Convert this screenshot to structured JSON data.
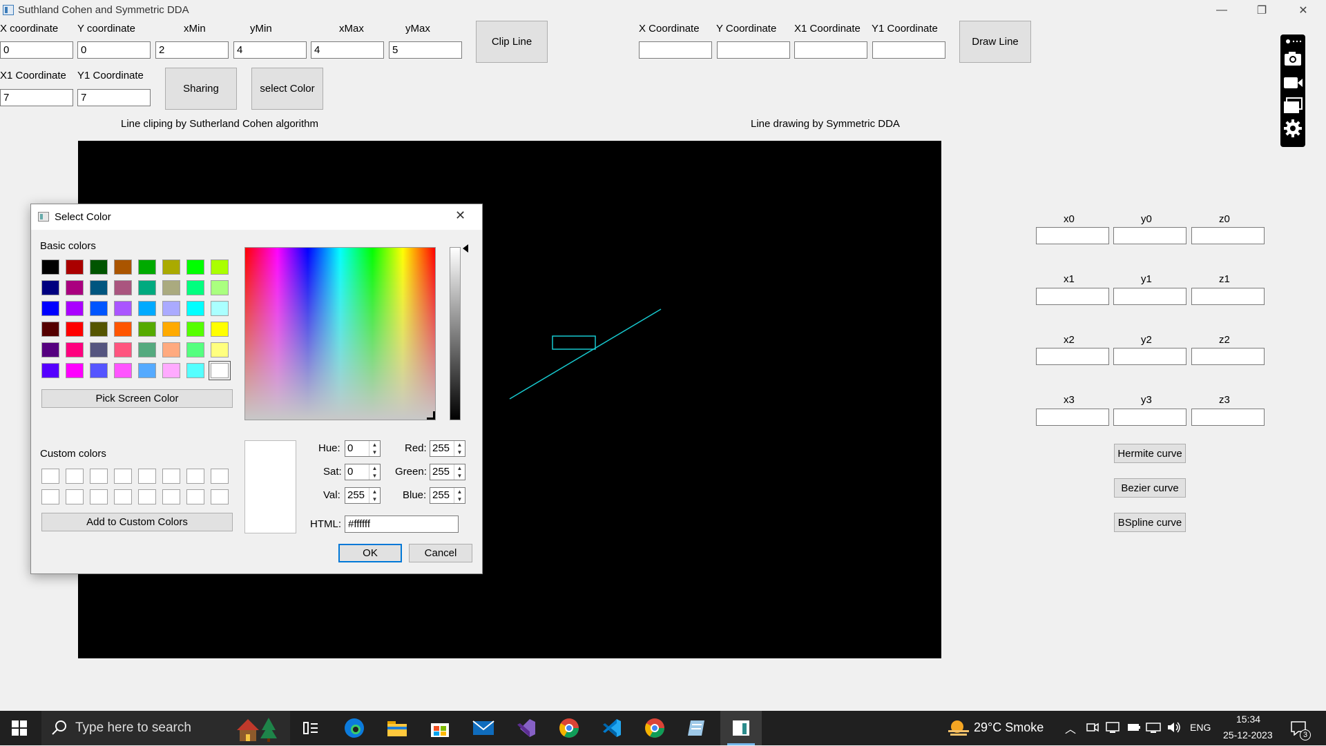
{
  "window": {
    "title": "Suthland Cohen and Symmetric DDA",
    "minimize": "—",
    "restore": "❐",
    "close": "✕"
  },
  "clip": {
    "labels": [
      "X coordinate",
      "Y coordinate",
      "xMin",
      "yMin",
      "xMax",
      "yMax"
    ],
    "values": [
      "0",
      "0",
      "2",
      "4",
      "4",
      "5"
    ],
    "x1_label": "X1 Coordinate",
    "y1_label": "Y1 Coordinate",
    "x1_value": "7",
    "y1_value": "7",
    "clip_button": "Clip Line",
    "sharing_button": "Sharing",
    "select_color_button": "select Color",
    "caption": "Line cliping by Sutherland Cohen algorithm"
  },
  "dda": {
    "labels": [
      "X Coordinate",
      "Y Coordinate",
      "X1 Coordinate",
      "Y1 Coordinate"
    ],
    "values": [
      "",
      "",
      "",
      ""
    ],
    "draw_button": "Draw Line",
    "caption": "Line drawing by Symmetric DDA"
  },
  "curves": {
    "rows": [
      {
        "labels": [
          "x0",
          "y0",
          "z0"
        ],
        "values": [
          "",
          "",
          ""
        ]
      },
      {
        "labels": [
          "x1",
          "y1",
          "z1"
        ],
        "values": [
          "",
          "",
          ""
        ]
      },
      {
        "labels": [
          "x2",
          "y2",
          "z2"
        ],
        "values": [
          "",
          "",
          ""
        ]
      },
      {
        "labels": [
          "x3",
          "y3",
          "z3"
        ],
        "values": [
          "",
          "",
          ""
        ]
      }
    ],
    "hermite_button": "Hermite curve",
    "bezier_button": "Bezier curve",
    "bspline_button": "BSpline curve"
  },
  "canvas": {
    "line_color": "#17c9cf",
    "background": "#000000"
  },
  "dialog": {
    "title": "Select Color",
    "basic_colors_label": "Basic colors",
    "basic_colors": [
      [
        "#000000",
        "#aa0000",
        "#005500",
        "#aa5500",
        "#00aa00",
        "#aaaa00",
        "#00ff00",
        "#aaff00"
      ],
      [
        "#00007f",
        "#aa007f",
        "#00557f",
        "#aa557f",
        "#00aa7f",
        "#aaaa7f",
        "#00ff7f",
        "#aaff7f"
      ],
      [
        "#0000ff",
        "#aa00ff",
        "#0055ff",
        "#aa55ff",
        "#00aaff",
        "#aaaaff",
        "#00ffff",
        "#aaffff"
      ],
      [
        "#550000",
        "#ff0000",
        "#555500",
        "#ff5500",
        "#55aa00",
        "#ffaa00",
        "#55ff00",
        "#ffff00"
      ],
      [
        "#55007f",
        "#ff007f",
        "#55557f",
        "#ff557f",
        "#55aa7f",
        "#ffaa7f",
        "#55ff7f",
        "#ffff7f"
      ],
      [
        "#5500ff",
        "#ff00ff",
        "#5555ff",
        "#ff55ff",
        "#55aaff",
        "#ffaaff",
        "#55ffff",
        "#ffffff"
      ]
    ],
    "selected_basic": "#ffffff",
    "pick_screen_button": "Pick Screen Color",
    "custom_colors_label": "Custom colors",
    "add_custom_button": "Add to Custom Colors",
    "hue_label": "Hue:",
    "hue_value": "0",
    "sat_label": "Sat:",
    "sat_value": "0",
    "val_label": "Val:",
    "val_value": "255",
    "red_label": "Red:",
    "red_value": "255",
    "green_label": "Green:",
    "green_value": "255",
    "blue_label": "Blue:",
    "blue_value": "255",
    "html_label": "HTML:",
    "html_value": "#ffffff",
    "ok_button": "OK",
    "cancel_button": "Cancel",
    "preview_color": "#ffffff"
  },
  "taskbar": {
    "search_placeholder": "Type here to search",
    "weather": "29°C Smoke",
    "language": "ENG",
    "time": "15:34",
    "date": "25-12-2023",
    "notification_count": "3"
  }
}
